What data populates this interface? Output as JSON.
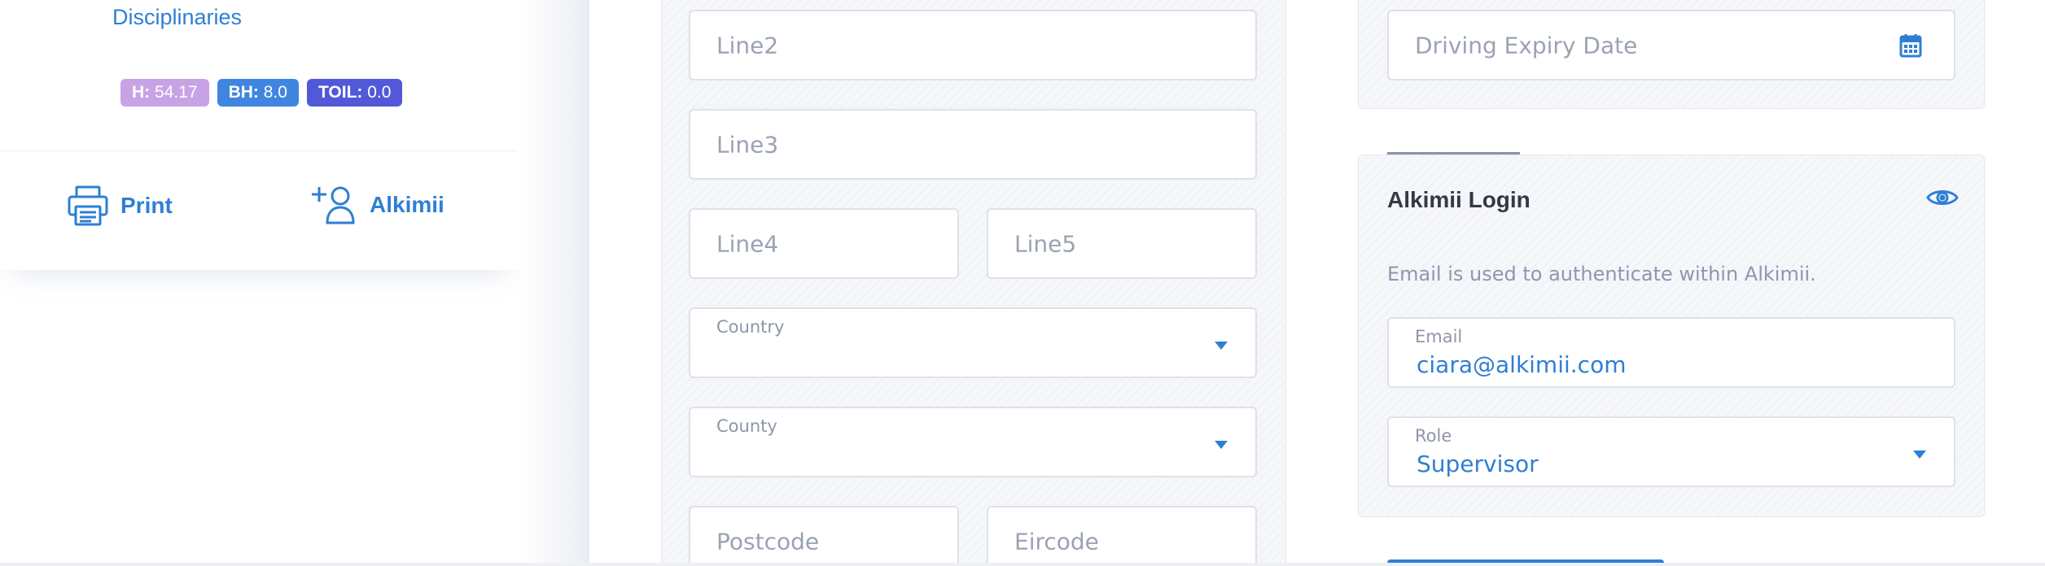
{
  "sidebar": {
    "disciplinaries_link": "Disciplinaries",
    "badges": [
      {
        "key": "H:",
        "value": "54.17",
        "color": "#c7a3e6"
      },
      {
        "key": "BH:",
        "value": "8.0",
        "color": "#3f86e0"
      },
      {
        "key": "TOIL:",
        "value": "0.0",
        "color": "#5159d9"
      }
    ],
    "actions": {
      "print_label": "Print",
      "print_icon": "printer-icon",
      "alkimii_label": "Alkimii",
      "alkimii_icon": "add-user-icon"
    }
  },
  "address_form": {
    "line2_placeholder": "Line2",
    "line3_placeholder": "Line3",
    "line4_placeholder": "Line4",
    "line5_placeholder": "Line5",
    "country_label": "Country",
    "country_value": "",
    "county_label": "County",
    "county_value": "",
    "postcode_placeholder": "Postcode",
    "eircode_placeholder": "Eircode"
  },
  "driving": {
    "expiry_placeholder": "Driving Expiry Date",
    "expiry_icon": "calendar-icon"
  },
  "alkimii_login": {
    "title": "Alkimii Login",
    "visibility_icon": "eye-icon",
    "description": "Email is used to authenticate within Alkimii.",
    "email_label": "Email",
    "email_value": "ciara@alkimii.com",
    "role_label": "Role",
    "role_value": "Supervisor"
  },
  "colors": {
    "accent": "#2e7fd4",
    "badge_h": "#c7a3e6",
    "badge_bh": "#3f86e0",
    "badge_toil": "#5159d9"
  }
}
